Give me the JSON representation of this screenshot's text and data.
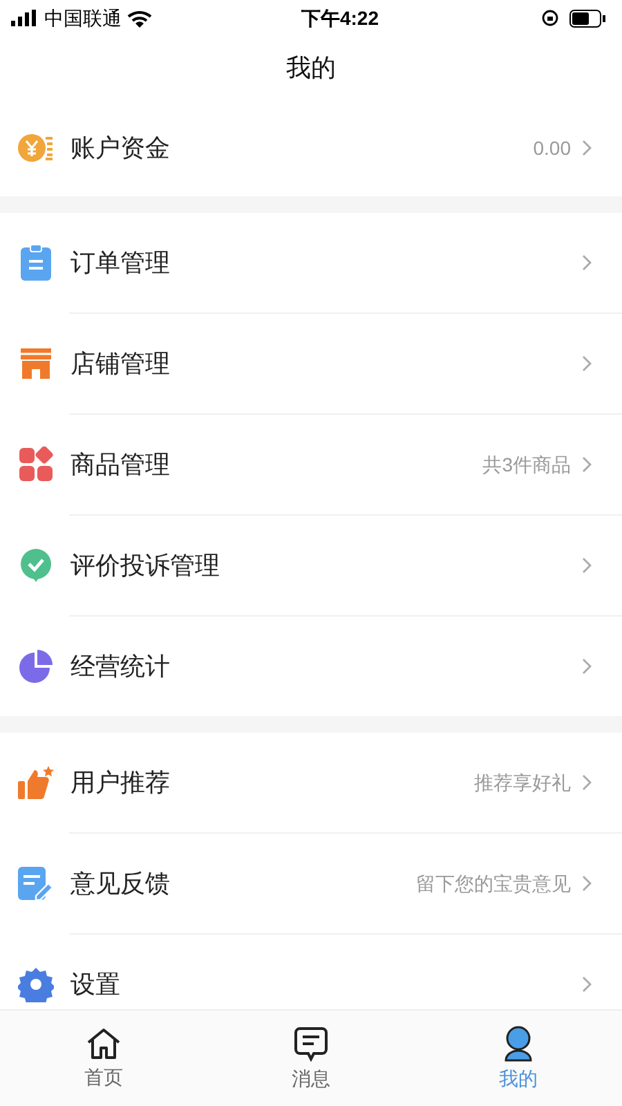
{
  "status_bar": {
    "carrier": "中国联通",
    "time": "下午4:22"
  },
  "title": "我的",
  "sections": [
    [
      {
        "label": "账户资金",
        "detail": "0.00"
      }
    ],
    [
      {
        "label": "订单管理"
      },
      {
        "label": "店铺管理"
      },
      {
        "label": "商品管理",
        "detail": "共3件商品"
      },
      {
        "label": "评价投诉管理"
      },
      {
        "label": "经营统计"
      }
    ],
    [
      {
        "label": "用户推荐",
        "detail": "推荐享好礼"
      },
      {
        "label": "意见反馈",
        "detail": "留下您的宝贵意见"
      },
      {
        "label": "设置"
      }
    ]
  ],
  "tabs": [
    {
      "label": "首页",
      "selected": false
    },
    {
      "label": "消息",
      "selected": false
    },
    {
      "label": "我的",
      "selected": true
    }
  ]
}
